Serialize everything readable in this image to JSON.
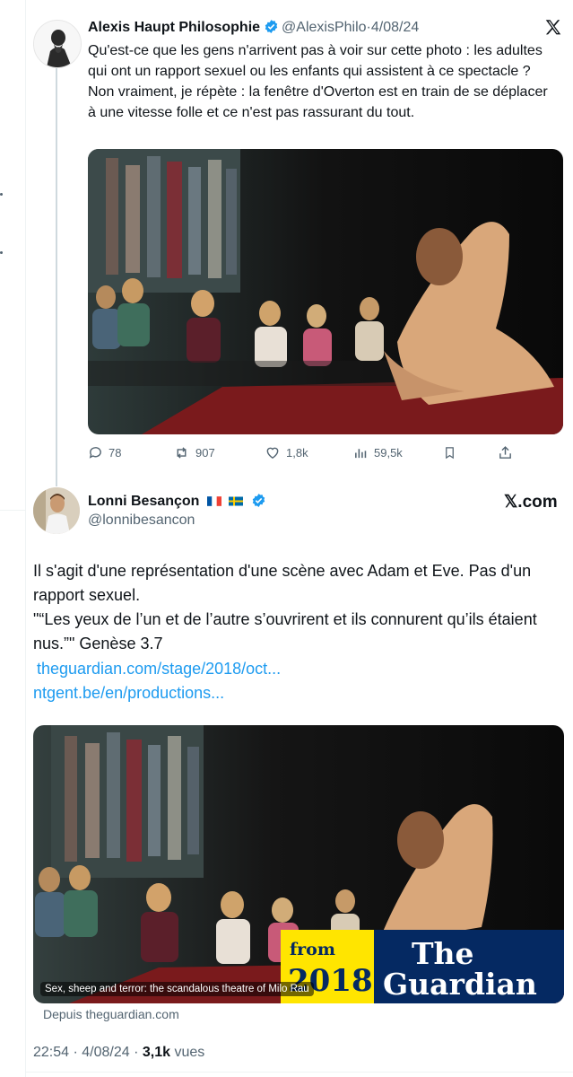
{
  "quoted_tweet": {
    "author_name": "Alexis Haupt Philosophie",
    "handle": "@AlexisPhilo",
    "separator": "·",
    "date": "4/08/24",
    "text_line1": "Qu'est-ce que les gens n'arrivent pas à voir sur cette photo : les adultes qui ont un rapport sexuel ou les enfants qui assistent à ce spectacle ?",
    "text_line2": "Non vraiment, je répète : la fenêtre d'Overton est en train de se déplacer à une vitesse folle et ce n'est pas rassurant du tout.",
    "actions": {
      "replies": "78",
      "reposts": "907",
      "likes": "1,8k",
      "views": "59,5k"
    }
  },
  "main_tweet": {
    "author_name": "Lonni Besançon",
    "handle": "@lonnibesancon",
    "brand": "𝕏.com",
    "text_line1": "Il s'agit d'une représentation d'une scène avec Adam et Eve. Pas d'un rapport sexuel.",
    "text_line2": "\"“Les yeux de l’un et de l’autre s’ouvrirent et ils connurent qu’ils étaient nus.”\" Genèse 3.7",
    "link1": "theguardian.com/stage/2018/oct...",
    "link2": "ntgent.be/en/productions...",
    "card": {
      "caption": "Sex, sheep and terror: the scandalous theatre of Milo Rau",
      "badge_from": "from",
      "badge_year": "2018",
      "badge_brand_line1": "The",
      "badge_brand_line2": "Guardian",
      "source": "Depuis theguardian.com"
    },
    "time": "22:54",
    "date": "4/08/24",
    "views_count": "3,1k",
    "views_label": "vues"
  },
  "colors": {
    "accent": "#1d9bf0",
    "secondary_text": "#536471",
    "guardian_blue": "#052962",
    "guardian_yellow": "#ffe500"
  }
}
